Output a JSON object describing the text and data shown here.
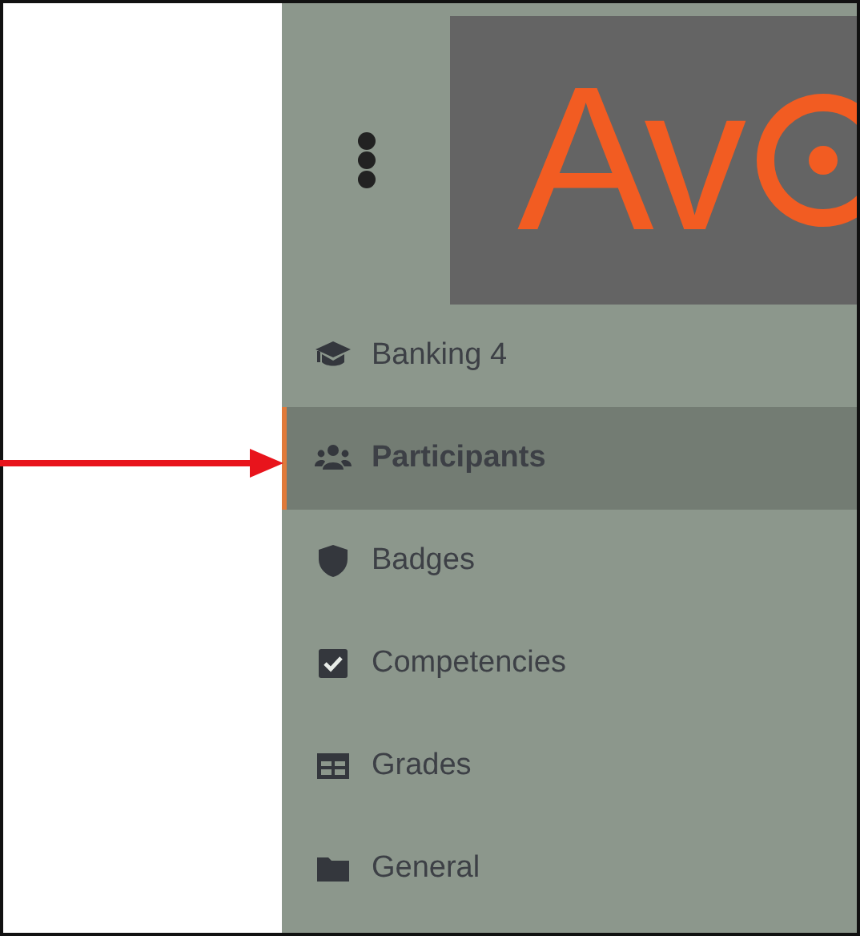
{
  "header": {
    "logo": {
      "text": "Av"
    }
  },
  "nav": [
    {
      "label": "Banking 4",
      "selected": false
    },
    {
      "label": "Participants",
      "selected": true
    },
    {
      "label": "Badges",
      "selected": false
    },
    {
      "label": "Competencies",
      "selected": false
    },
    {
      "label": "Grades",
      "selected": false
    },
    {
      "label": "General",
      "selected": false
    }
  ]
}
